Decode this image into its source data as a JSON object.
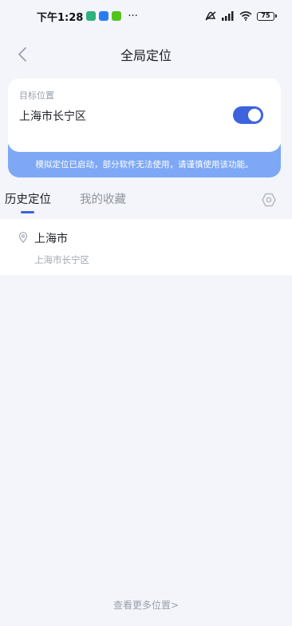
{
  "status_bar": {
    "time": "下午1:28",
    "more": "···",
    "battery": "75",
    "app_icon_colors": [
      "#2fb37a",
      "#2a7cf6",
      "#52c41a"
    ]
  },
  "header": {
    "title": "全局定位"
  },
  "target": {
    "label": "目标位置",
    "value": "上海市长宁区",
    "toggle_on": true,
    "notice": "模拟定位已启动，部分软件无法使用，请谨慎使用该功能。"
  },
  "tabs": [
    {
      "label": "历史定位",
      "active": true
    },
    {
      "label": "我的收藏",
      "active": false
    }
  ],
  "history": [
    {
      "title": "上海市",
      "subtitle": "上海市长宁区"
    }
  ],
  "footer": {
    "more_label": "查看更多位置>"
  },
  "colors": {
    "accent": "#3e63dd",
    "notice_bg": "#7ea8f5",
    "page_bg": "#f3f5fa"
  }
}
